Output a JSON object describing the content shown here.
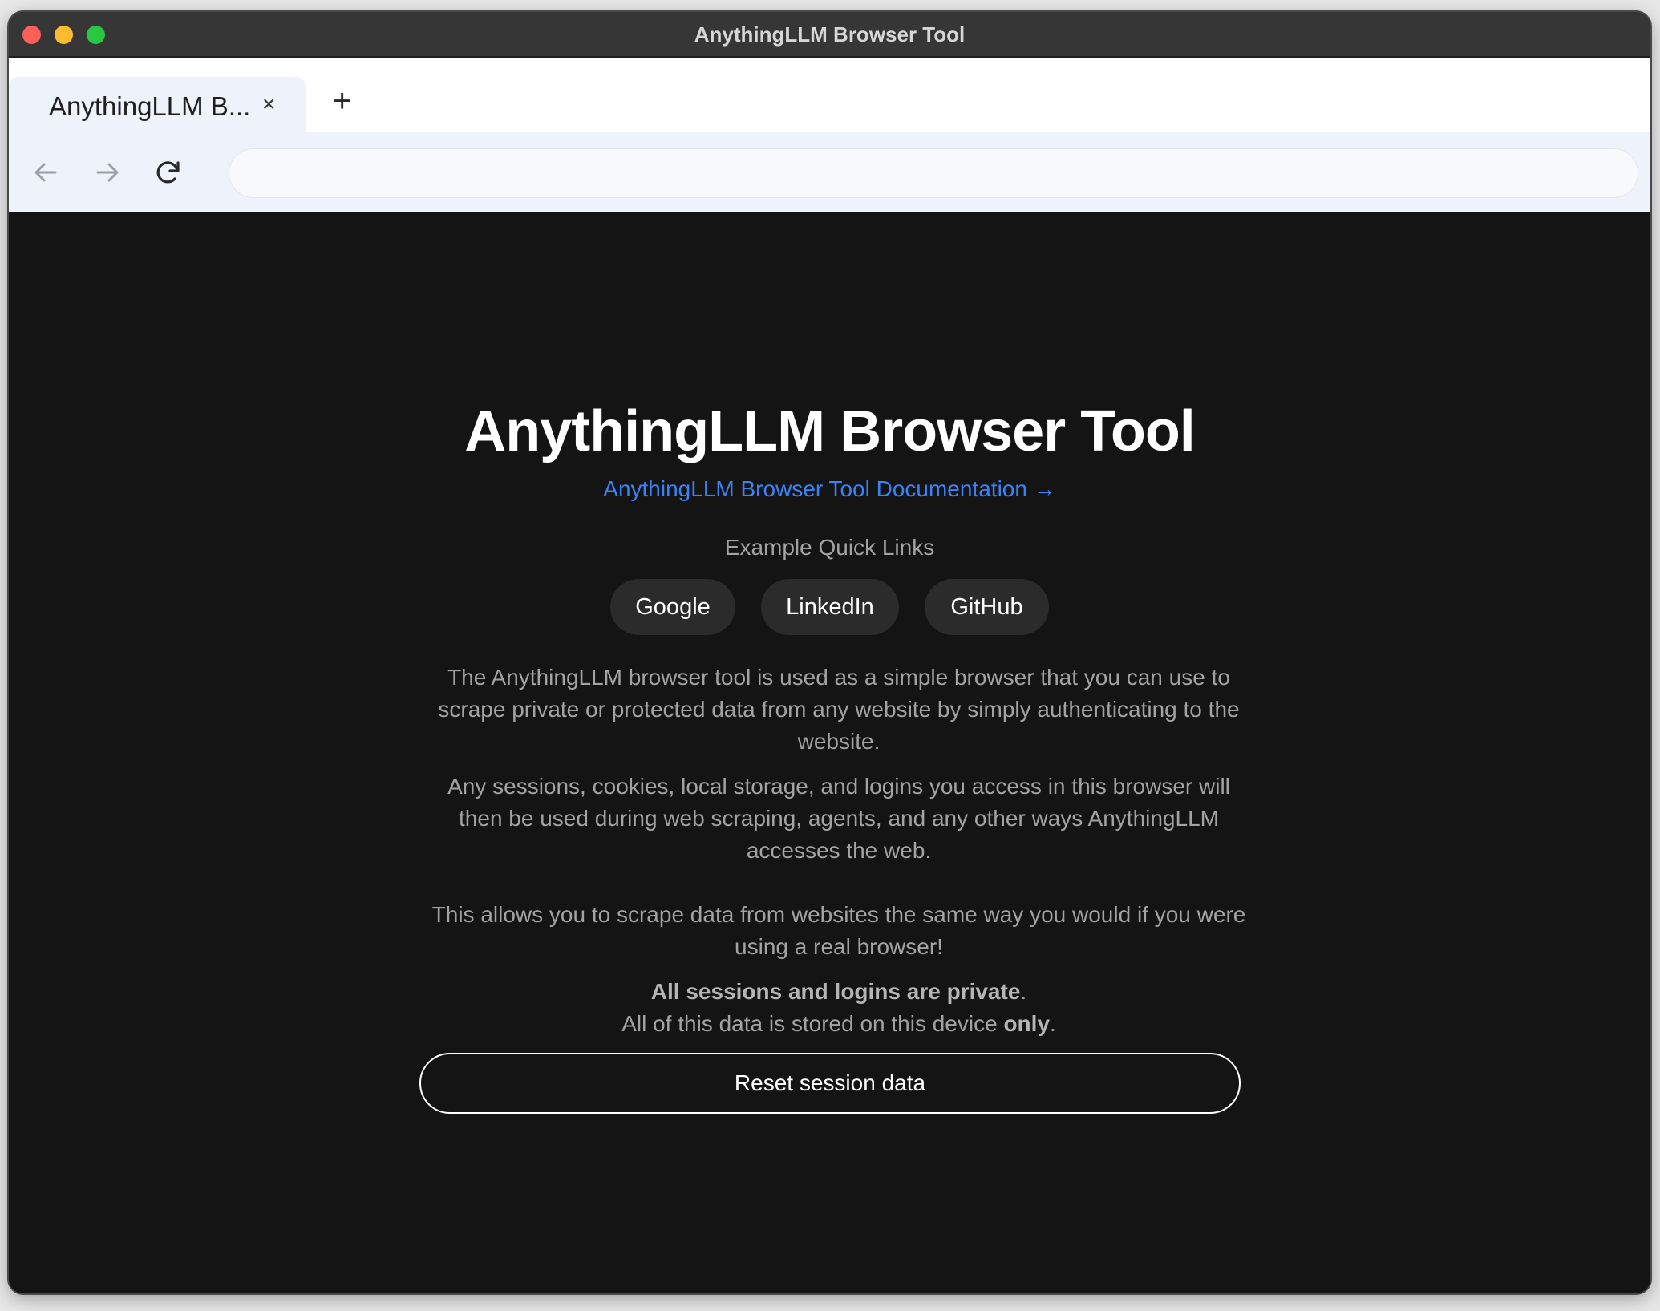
{
  "window": {
    "title": "AnythingLLM Browser Tool"
  },
  "tabs": [
    {
      "label": "AnythingLLM B...",
      "close_glyph": "×"
    }
  ],
  "new_tab_glyph": "+",
  "toolbar": {
    "back_icon": "arrow-left-icon",
    "forward_icon": "arrow-right-icon",
    "reload_icon": "reload-icon",
    "address_value": "",
    "address_placeholder": ""
  },
  "page": {
    "title": "AnythingLLM Browser Tool",
    "doc_link": "AnythingLLM Browser Tool Documentation →",
    "quick_links_label": "Example Quick Links",
    "quick_links": [
      "Google",
      "LinkedIn",
      "GitHub"
    ],
    "paragraph_1": "The AnythingLLM browser tool is used as a simple browser that you can use to scrape private or protected data from any website by simply authenticating to the website.",
    "paragraph_2": "Any sessions, cookies, local storage, and logins you access in this browser will then be used during web scraping, agents, and any other ways AnythingLLM accesses the web.",
    "paragraph_3": "This allows you to scrape data from websites the same way you would if you were using a real browser!",
    "privacy_bold": "All sessions and logins are private",
    "privacy_period": ".",
    "storage_text": "All of this data is stored on this device ",
    "storage_bold": "only",
    "storage_period": ".",
    "reset_button": "Reset session data"
  },
  "colors": {
    "titlebar": "#363636",
    "toolbar": "#eef2fb",
    "content_bg": "#141414",
    "link": "#3b82f6",
    "pill_bg": "#2b2b2b"
  }
}
